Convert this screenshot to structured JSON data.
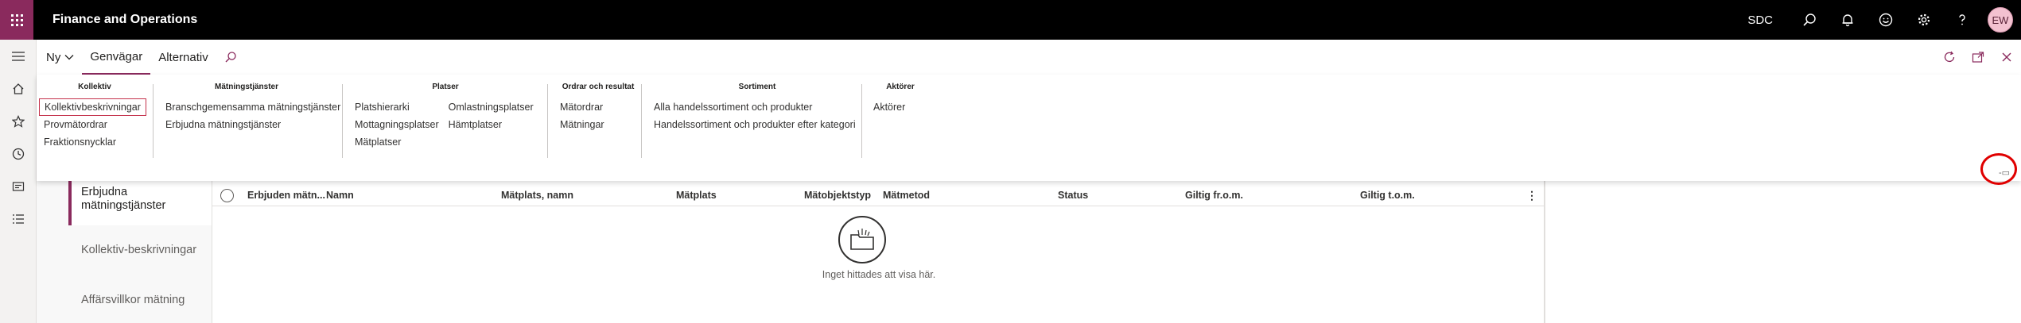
{
  "topbar": {
    "app_title": "Finance and Operations",
    "company": "SDC",
    "avatar_initials": "EW",
    "waffle_color": "#8a2a5d"
  },
  "actionbar": {
    "new_label": "Ny",
    "tabs": [
      {
        "label": "Genvägar",
        "active": true
      },
      {
        "label": "Alternativ",
        "active": false
      }
    ]
  },
  "ribbon": {
    "groups": [
      {
        "title": "Kollektiv",
        "columns": [
          [
            "Kollektivbeskrivningar",
            "Provmätordrar",
            "Fraktionsnycklar"
          ]
        ]
      },
      {
        "title": "Mätningstjänster",
        "columns": [
          [
            "Branschgemensamma mätningstjänster",
            "Erbjudna mätningstjänster"
          ]
        ]
      },
      {
        "title": "Platser",
        "columns": [
          [
            "Platshierarki",
            "Mottagningsplatser",
            "Mätplatser"
          ],
          [
            "Omlastningsplatser",
            "Hämtplatser"
          ]
        ]
      },
      {
        "title": "Ordrar och resultat",
        "columns": [
          [
            "Mätordrar",
            "Mätningar"
          ]
        ]
      },
      {
        "title": "Sortiment",
        "columns": [
          [
            "Alla handelssortiment och produkter",
            "Handelssortiment och produkter efter kategori"
          ]
        ]
      },
      {
        "title": "Aktörer",
        "columns": [
          [
            "Aktörer"
          ]
        ]
      }
    ],
    "collapse_label": "-▭"
  },
  "content": {
    "vtabs": [
      {
        "label": "Erbjudna mätningstjänster",
        "active": true
      },
      {
        "label": "Kollektiv-beskrivningar",
        "active": false
      },
      {
        "label": "Affärsvillkor mätning",
        "active": false
      }
    ],
    "grid": {
      "columns": [
        "Erbjuden mätn...",
        "Namn",
        "Mätplats, namn",
        "Mätplats",
        "Mätobjektstyp",
        "Mätmetod",
        "Status",
        "Giltig fr.o.m.",
        "Giltig t.o.m."
      ],
      "empty_text": "Inget hittades att visa här."
    }
  }
}
